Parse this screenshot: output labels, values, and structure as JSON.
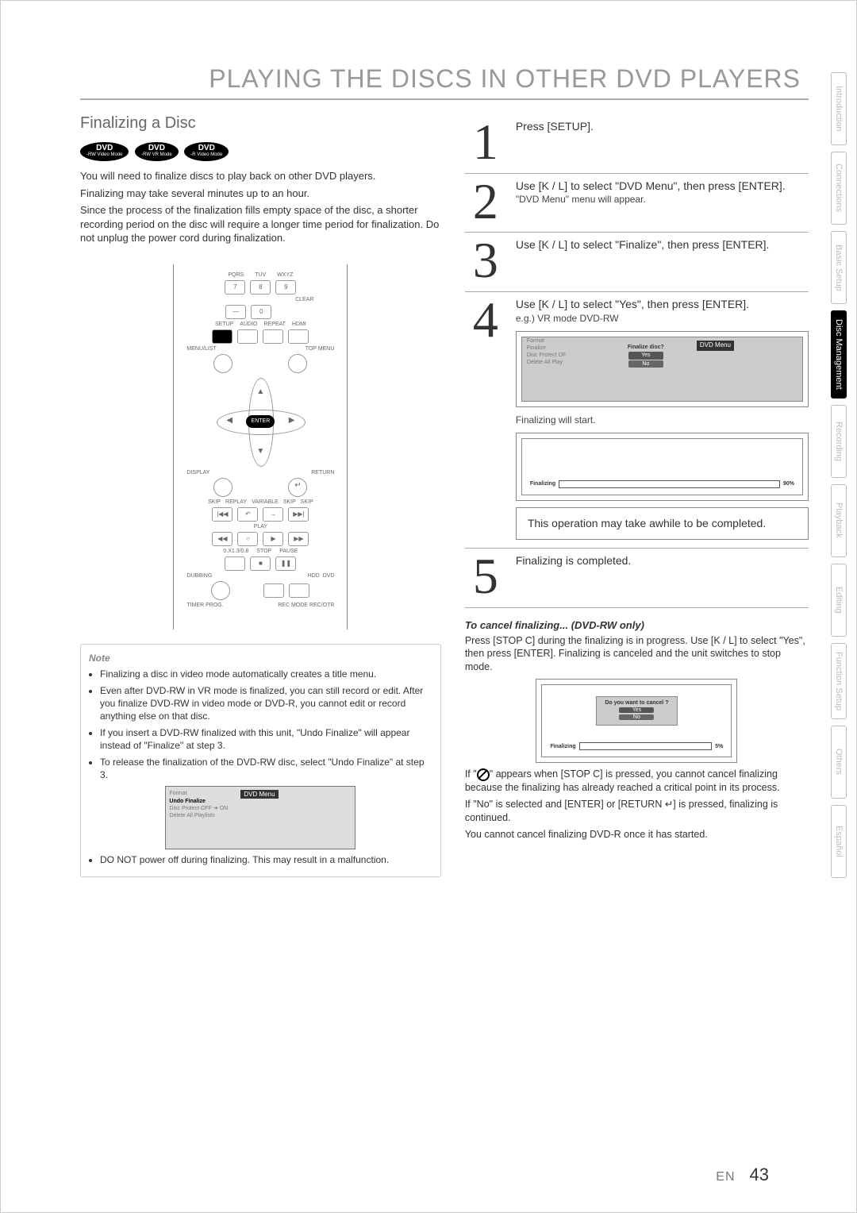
{
  "title": "PLAYING THE DISCS IN OTHER DVD PLAYERS",
  "subtitle": "Finalizing a Disc",
  "disc_types": [
    "DVD-RW Video Mode",
    "DVD-RW VR Mode",
    "DVD-R Video Mode"
  ],
  "intro": {
    "p1": "You will need to finalize discs to play back on other DVD players.",
    "p2": "Finalizing may take several minutes up to an hour.",
    "p3": "Since the process of the finalization fills empty space of the disc, a shorter recording period on the disc will require a longer time period for finalization. Do not unplug the power cord during finalization."
  },
  "remote": {
    "row1": [
      "PQRS",
      "TUV",
      "WXYZ"
    ],
    "keys1": [
      "7",
      "8",
      "9"
    ],
    "clear": "CLEAR",
    "keys2": [
      "—",
      "0"
    ],
    "row3": [
      "SETUP",
      "AUDIO",
      "REPEAT",
      "HDMI"
    ],
    "menulist": "MENU/LIST",
    "topmenu": "TOP MENU",
    "enter": "ENTER",
    "display": "DISPLAY",
    "return": "RETURN",
    "variable": "VARIABLE",
    "skip": "SKIP",
    "replay": "REPLAY",
    "play": "PLAY",
    "speed": "0.X1.3/0.8",
    "stop": "STOP",
    "pause": "PAUSE",
    "dubbing": "DUBBING",
    "hdd": "HDD",
    "dvd": "DVD",
    "timer": "TIMER PROG.",
    "recmode": "REC MODE",
    "recotr": "REC/OTR"
  },
  "note": {
    "title": "Note",
    "items": [
      "Finalizing a disc in video mode automatically creates a title menu.",
      "Even after DVD-RW in VR mode is finalized, you can still record or edit. After you finalize DVD-RW in video mode or DVD-R, you cannot edit or record anything else on that disc.",
      "If you insert a DVD-RW finalized with this unit, \"Undo Finalize\" will appear instead of \"Finalize\" at step 3.",
      "To release the finalization of the DVD-RW disc, select \"Undo Finalize\" at step 3."
    ],
    "screen_header": "DVD Menu",
    "screen_items": [
      "Format",
      "Undo Finalize",
      "Disc Protect OFF ➔ ON",
      "Delete All Playlists"
    ],
    "last": "DO NOT power off during finalizing. This may result in a malfunction."
  },
  "steps": {
    "s1": "Press [SETUP].",
    "s2": "Use [K / L] to select \"DVD Menu\", then press [ENTER].",
    "s2b": "\"DVD Menu\" menu will appear.",
    "s3": "Use [K / L] to select \"Finalize\", then press [ENTER].",
    "s4": "Use [K / L] to select \"Yes\", then press [ENTER].",
    "s4b": "e.g.) VR mode DVD-RW",
    "s4_screen_header": "DVD Menu",
    "s4_screen_items": [
      "Format",
      "Finalize",
      "Disc Protect OF",
      "Delete All Play"
    ],
    "s4_prompt": "Finalize disc?",
    "s4_yes": "Yes",
    "s4_no": "No",
    "s4c": "Finalizing will start.",
    "s4_progress_label": "Finalizing",
    "s4_progress_pct": "90%",
    "s4d": "This operation may take awhile to be completed.",
    "s5": "Finalizing is completed."
  },
  "cancel": {
    "title": "To cancel finalizing... (DVD-RW only)",
    "p1": "Press [STOP C] during the finalizing is in progress. Use [K / L] to select \"Yes\", then press [ENTER]. Finalizing is canceled and the unit switches to stop mode.",
    "screen_prompt": "Do you want to cancel ?",
    "yes": "Yes",
    "no": "No",
    "progress_label": "Finalizing",
    "progress_pct": "5%",
    "p2a": "If \"",
    "p2b": "\" appears when [STOP C] is pressed, you cannot cancel finalizing because the finalizing has already reached a critical point in its process.",
    "p3": "If \"No\" is selected and [ENTER] or [RETURN ↵] is pressed, finalizing is continued.",
    "p4": "You cannot cancel finalizing DVD-R once it has started."
  },
  "page": {
    "label": "EN",
    "num": "43"
  },
  "tabs": [
    "Introduction",
    "Connections",
    "Basic Setup",
    "Disc Management",
    "Recording",
    "Playback",
    "Editing",
    "Function Setup",
    "Others",
    "Español"
  ],
  "active_tab": "Disc Management"
}
